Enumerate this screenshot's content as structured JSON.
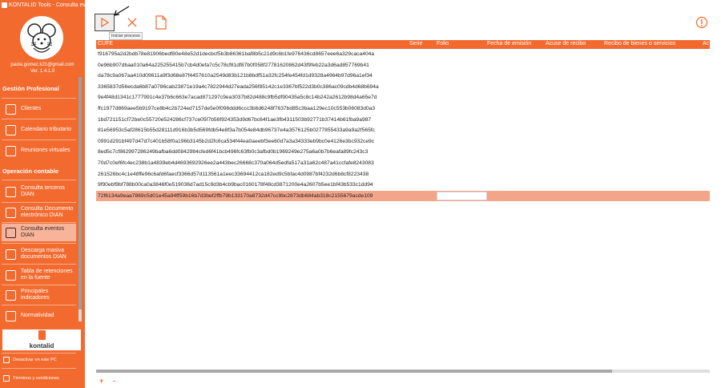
{
  "window": {
    "title": "KONTALID Tools - Consulta eventos DIAN"
  },
  "user": {
    "email": "paola.gomez.k21@gmail.com",
    "version": "Ver. 1.4.1.0"
  },
  "sidebar": {
    "sections": [
      {
        "title": "Gestión Profesional"
      },
      {
        "title": "Operación contable"
      }
    ],
    "items": [
      {
        "label": "Clientes"
      },
      {
        "label": "Calendario tributario"
      },
      {
        "label": "Reuniones virtuales"
      },
      {
        "label": "Consulta terceros DIAN"
      },
      {
        "label": "Consulta Documento electrónico DIAN"
      },
      {
        "label": "Consulta eventos DIAN"
      },
      {
        "label": "Descarga masiva documentos DIAN"
      },
      {
        "label": "Tabla de retenciones en la fuente"
      },
      {
        "label": "Principales indicadores"
      },
      {
        "label": "Normatividad"
      }
    ],
    "active_item": "Consulta eventos DIAN",
    "logo_text": "kontalid",
    "bottom_links": [
      {
        "label": "Desactivar en este PC"
      },
      {
        "label": "Términos y condiciones"
      }
    ]
  },
  "toolbar": {
    "run_icon": "play-icon",
    "cancel_icon": "close-icon",
    "doc_icon": "document-icon",
    "info_icon": "info-icon",
    "tooltip": "Iniciar proceso"
  },
  "grid": {
    "columns": [
      "CUFE",
      "Serie",
      "Folio",
      "Fecha de emisión",
      "Acuse de recibo",
      "Recibo de bienes o servicios",
      "Ac"
    ],
    "rows": [
      {
        "cufe": "f916795a2d2bdb78e81906bedf80e48e52d1decbcf5b3b86361baf8b5c21d9c6b1fe976436cd8657eee6a329caca404a"
      },
      {
        "cufe": "0e96b907dbaa010a64a225255415b7cb4d0efa7c5c78cf81df87b0f058f27781620862d43f9feb22a3d6ad857769b41"
      },
      {
        "cufe": "da78c9a067aa410d09611a9f3d68e87f4457610a2549d83b121b8bdf51a32fc254fe454fd1d9328a4964b97d96a1ef34"
      },
      {
        "cufe": "3365837d56ecda6b87a0786cab23871e19a4c7822944d27eada256f85142c1e3367bf522d3b0c386ac09cdb4d68b694a"
      },
      {
        "cufe": "9e4f48d1341c1777991c4e37b6c663e7acad871297c9ea3037b82d488c9fb5df90435a5c8c14b242a2612b98d4a65e7d"
      },
      {
        "cufe": "ffc1977d869aee5b9197ce8b4c2b724ed7157de5e0f098ddd6ccc3b6d6248f7637bd85c3baa129ec10c553b06083d0a3"
      },
      {
        "cufe": "1bd721151cf72be0c55720e524286cf737ce05f7b56f924353d9d67bc64f1ae3fb4311503b92771b37414b61fba9a987"
      },
      {
        "cufe": "81e56953c5af28615b55d28111d916b3b5d569fdb54e8f3a7b054e84db96737e4a3576125b0277855433a9a9a2f565fc"
      },
      {
        "cufe": "0991d291bf497d47d7c401b58f0a196b3145b2d2fc6ca534f44ea0aeebf3ee60d7a3a34333eb9bc0e4126e3bc932ce9c"
      },
      {
        "cufe": "8ed5c7cf862997286249bafba6dd0842984cfed6f41bcb496fc63fb0c3afbd0b1969249e275a6a0b7b6eafa89fc243c3"
      },
      {
        "cufe": "70d7c0ef6fc4ec238b1a4839eb4d4693692926ee2a443bec26668c370a064d5edfa517a31a62c487a41ccfafe8243083"
      },
      {
        "cufe": "261526bc4c1e48ffe96c6afd6faecf3366d57d113561a1eec33694412ca182ed9c5bfac4d0987bf4232d6b8cf8223438"
      },
      {
        "cufe": "9f90ebf9bf788b00ca0a3846f0e519036d7ad15c9d3b4cb9bac0160178f48cd3871200e4a2607b5ee1bf43b533c1dd94"
      },
      {
        "cufe": "72f6134a9eaa7869c5d01e45a94ff59b16b7d3bef2ffb79b133170a8732d47cc9bc2873db684ab318c2155679acde109"
      }
    ],
    "selected_row": 13
  },
  "footer": {
    "add": "+",
    "remove": "-"
  },
  "colors": {
    "accent": "#f26a2e",
    "selected_row": "#f3a58a"
  }
}
